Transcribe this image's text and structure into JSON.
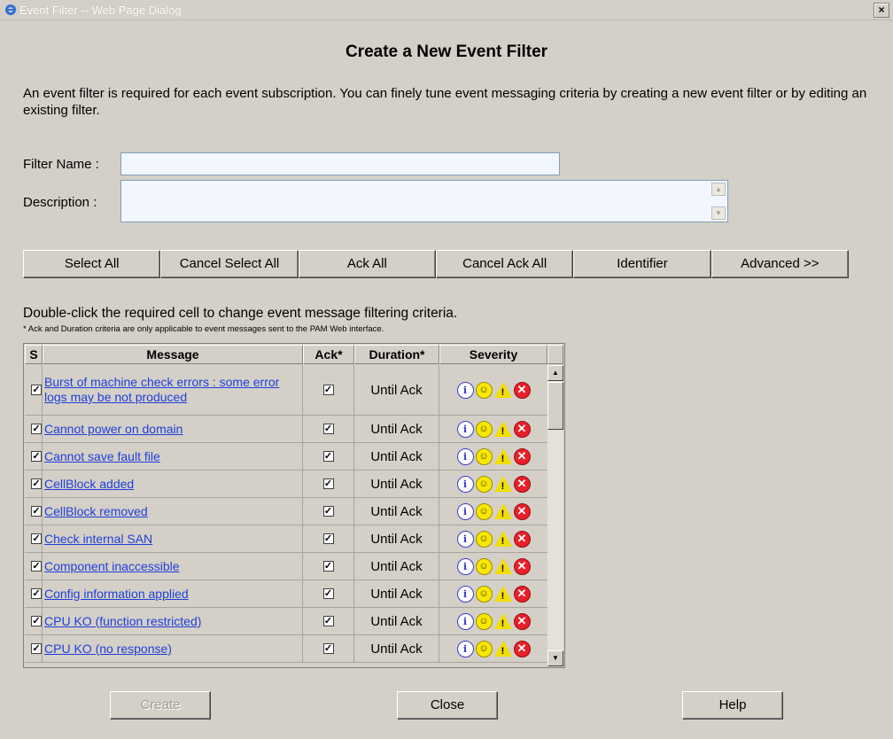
{
  "window": {
    "title": "Event Filter -- Web Page Dialog",
    "close_glyph": "×"
  },
  "heading": "Create a New Event Filter",
  "intro": "An event filter is required for each event subscription. You can finely tune event messaging criteria by creating a new event filter or by editing an existing filter.",
  "form": {
    "filter_name_label": "Filter Name :",
    "filter_name_value": "",
    "description_label": "Description :",
    "description_value": ""
  },
  "toolbar": {
    "select_all": "Select All",
    "cancel_select_all": "Cancel Select All",
    "ack_all": "Ack All",
    "cancel_ack_all": "Cancel Ack All",
    "identifier": "Identifier",
    "advanced": "Advanced >>"
  },
  "grid_hint": "Double-click the required cell to change event message filtering criteria.",
  "grid_note": "* Ack and Duration criteria are only applicable to event messages sent to the PAM Web interface.",
  "grid": {
    "headers": {
      "s": "S",
      "message": "Message",
      "ack": "Ack*",
      "duration": "Duration*",
      "severity": "Severity"
    },
    "rows": [
      {
        "message": "Burst of machine check errors : some error logs may be not produced",
        "selected": true,
        "ack": true,
        "duration": "Until Ack"
      },
      {
        "message": "Cannot power on domain",
        "selected": true,
        "ack": true,
        "duration": "Until Ack"
      },
      {
        "message": "Cannot save fault file",
        "selected": true,
        "ack": true,
        "duration": "Until Ack"
      },
      {
        "message": "CellBlock added",
        "selected": true,
        "ack": true,
        "duration": "Until Ack"
      },
      {
        "message": "CellBlock removed",
        "selected": true,
        "ack": true,
        "duration": "Until Ack"
      },
      {
        "message": "Check internal SAN",
        "selected": true,
        "ack": true,
        "duration": "Until Ack"
      },
      {
        "message": "Component inaccessible",
        "selected": true,
        "ack": true,
        "duration": "Until Ack"
      },
      {
        "message": "Config information applied",
        "selected": true,
        "ack": true,
        "duration": "Until Ack"
      },
      {
        "message": "CPU KO (function restricted)",
        "selected": true,
        "ack": true,
        "duration": "Until Ack"
      },
      {
        "message": "CPU KO (no response)",
        "selected": true,
        "ack": true,
        "duration": "Until Ack"
      }
    ],
    "severity_icons": [
      "info-icon",
      "success-smiley-icon",
      "warning-icon",
      "error-icon"
    ]
  },
  "buttons": {
    "create": "Create",
    "close": "Close",
    "help": "Help"
  },
  "colors": {
    "dialog_bg": "#d4d0c8",
    "link": "#1f3fd9",
    "input_bg": "#f2f7ff"
  }
}
